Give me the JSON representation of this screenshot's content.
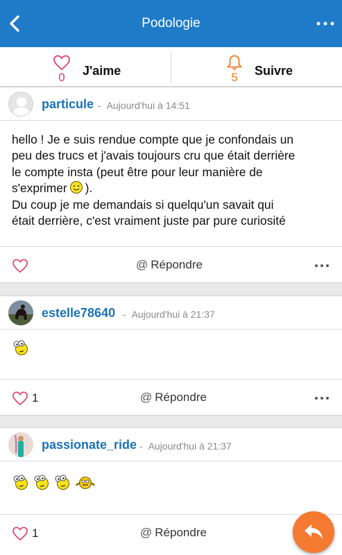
{
  "header": {
    "title": "Podologie"
  },
  "actions": {
    "like": {
      "count": "0",
      "label": "J'aime"
    },
    "follow": {
      "count": "5",
      "label": "Suivre"
    }
  },
  "posts": [
    {
      "username": "particule",
      "separator": "-",
      "timestamp": "Aujourd'hui à 14:51",
      "text_lines": [
        "hello ! Je e suis rendue compte que je confondais un",
        "peu des trucs et j'avais toujours cru que était derrière",
        "le compte insta (peut être pour leur manière de",
        "s'exprimer",
        ").",
        "Du coup je me demandais si quelqu'un savait qui",
        "était derrière, c'est vraiment juste par pure curiosité"
      ],
      "likes": "",
      "reply_at": "@",
      "reply_label": "Répondre"
    },
    {
      "username": "estelle78640",
      "separator": "-",
      "timestamp": "Aujourd'hui à 21:37",
      "likes": "1",
      "reply_at": "@",
      "reply_label": "Répondre"
    },
    {
      "username": "passionate_ride",
      "separator": "-",
      "timestamp": "Aujourd'hui à 21:37",
      "likes": "1",
      "reply_at": "@",
      "reply_label": "Répondre"
    }
  ],
  "colors": {
    "appbar": "#1f7bc8",
    "username": "#1b72b8",
    "like_accent": "#e53a6a",
    "follow_accent": "#f07a22",
    "fab": "#f47a32"
  },
  "icons": [
    "back-icon",
    "more-icon",
    "heart-icon",
    "bell-icon",
    "smiley-icon",
    "reply-icon",
    "dots-icon"
  ]
}
